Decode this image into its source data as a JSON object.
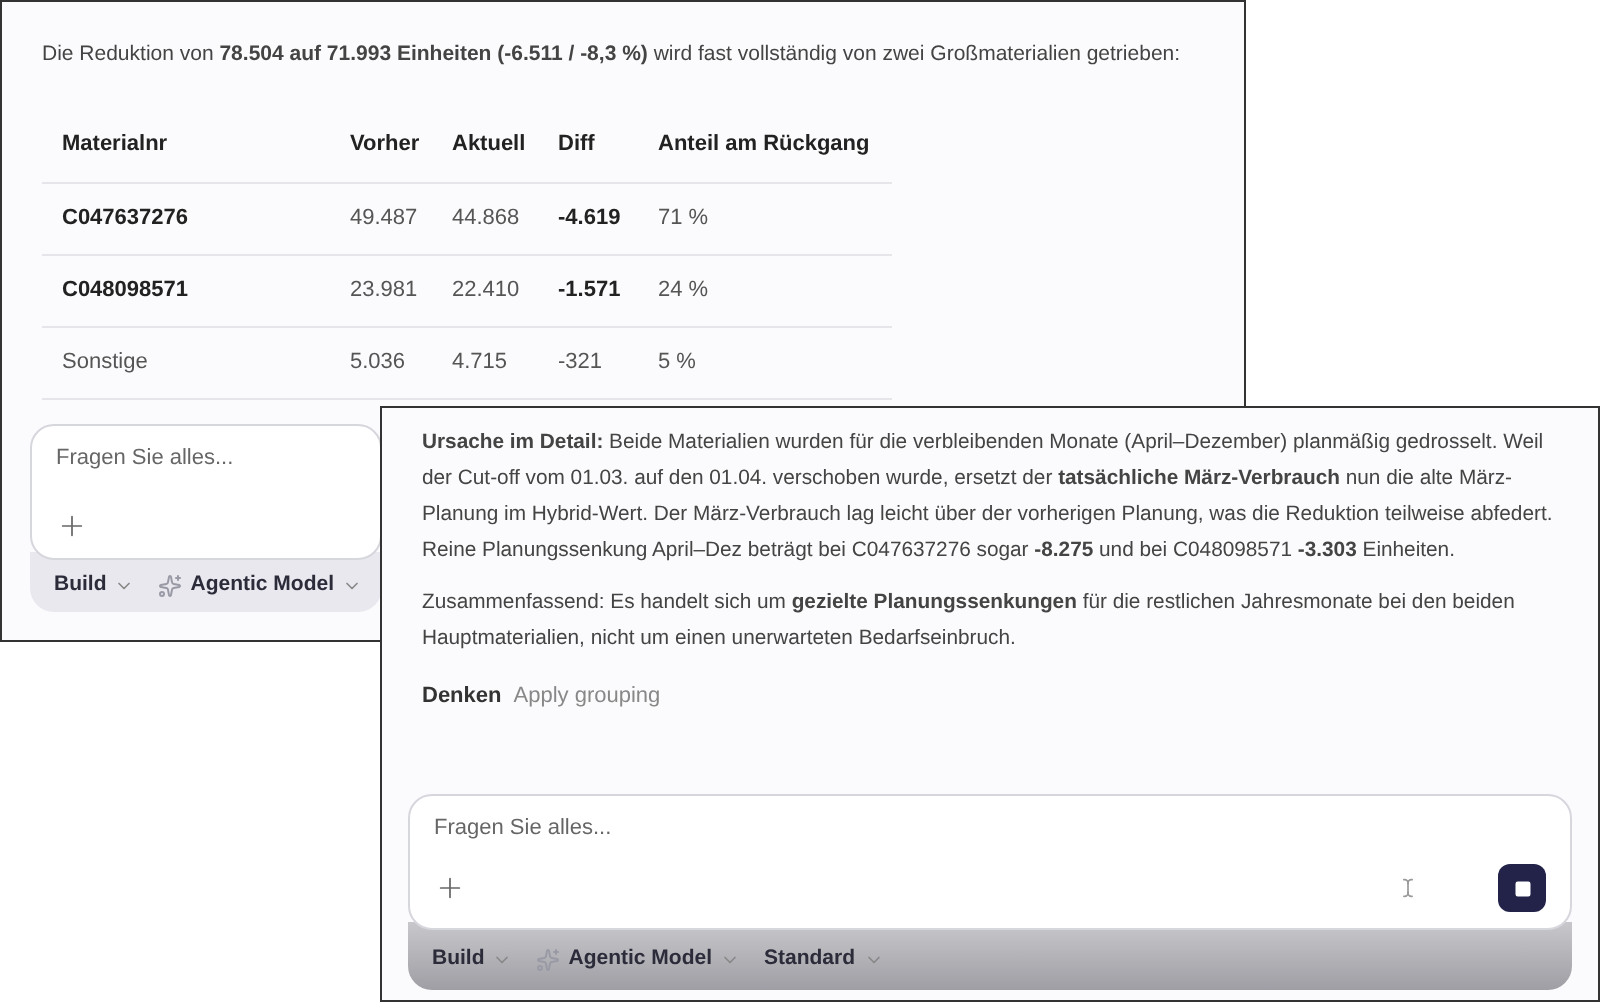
{
  "back_window": {
    "intro": "Die Reduktion von **78.504 auf 71.993 Einheiten (-6.511 / -8,3 %)** wird fast vollständig von zwei Großmaterialien getrieben:",
    "table": {
      "columns": [
        "Materialnr",
        "Vorher",
        "Aktuell",
        "Diff",
        "Anteil am Rückgang"
      ],
      "rows": [
        {
          "emphasis": true,
          "cells": [
            "C047637276",
            "49.487",
            "44.868",
            "-4.619",
            "71 %"
          ]
        },
        {
          "emphasis": true,
          "cells": [
            "C048098571",
            "23.981",
            "22.410",
            "-1.571",
            "24 %"
          ]
        },
        {
          "emphasis": false,
          "cells": [
            "Sonstige",
            "5.036",
            "4.715",
            "-321",
            "5 %"
          ]
        }
      ]
    },
    "composer": {
      "placeholder": "Fragen Sie alles..."
    },
    "toolbar": [
      {
        "kind": "plain",
        "label": "Build"
      },
      {
        "kind": "sparkle",
        "label": "Agentic Model"
      }
    ]
  },
  "front_window": {
    "paragraphs": [
      "**Ursache im Detail:** Beide Materialien wurden für die verbleibenden Monate (April–Dezember) planmäßig gedrosselt. Weil der Cut-off vom 01.03. auf den 01.04. verschoben wurde, ersetzt der **tatsächliche März-Verbrauch** nun die alte März-Planung im Hybrid-Wert. Der März-Verbrauch lag leicht über der vorherigen Planung, was die Reduktion teilweise abfedert. Reine Planungssenkung April–Dez beträgt bei C047637276 sogar **-8.275** und bei C048098571 **-3.303** Einheiten.",
      "Zusammenfassend: Es handelt sich um **gezielte Planungssenkungen** für die restlichen Jahresmonate bei den beiden Hauptmaterialien, nicht um einen unerwarteten Bedarfseinbruch."
    ],
    "footer": {
      "thinking": "Denken",
      "action": "Apply grouping"
    },
    "composer": {
      "placeholder": "Fragen Sie alles...",
      "busy": true
    },
    "toolbar": [
      {
        "kind": "plain",
        "label": "Build"
      },
      {
        "kind": "sparkle",
        "label": "Agentic Model"
      },
      {
        "kind": "plain",
        "label": "Standard"
      }
    ]
  }
}
